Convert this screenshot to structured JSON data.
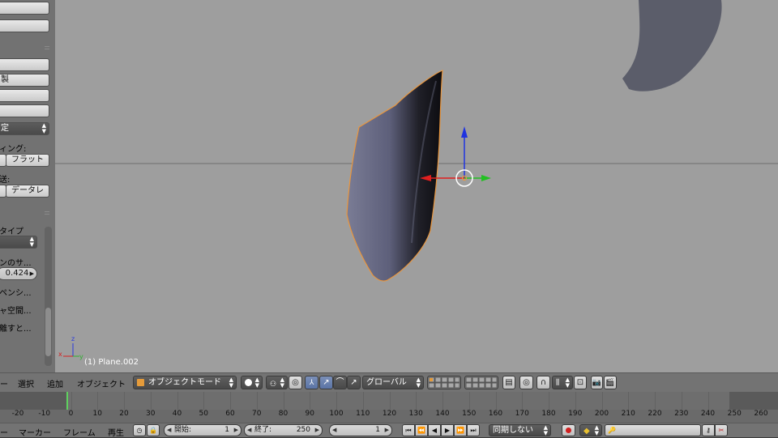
{
  "shelf": {
    "partial_labels": {
      "duplicate": "製",
      "set": "定",
      "shading_label": "ィング:",
      "flat_button": "フラット",
      "transfer_label": "送:",
      "data_button": "データレ",
      "type_label": "タイプ",
      "sun_label": "ンのサ...",
      "value": "0.424",
      "compensate_label": "ペンシ...",
      "space_label": "ャ空間...",
      "distance_label": "離すと..."
    }
  },
  "viewport": {
    "object_name": "(1) Plane.002",
    "axis_labels": {
      "x": "x",
      "y": "y",
      "z": "z"
    }
  },
  "header": {
    "menus": {
      "partial": "ー",
      "select": "選択",
      "add": "追加",
      "object": "オブジェクト"
    },
    "mode": "オブジェクトモード",
    "orientation": "グローバル"
  },
  "timeline": {
    "ticks": [
      "-20",
      "-10",
      "0",
      "10",
      "20",
      "30",
      "40",
      "50",
      "60",
      "70",
      "80",
      "90",
      "100",
      "110",
      "120",
      "130",
      "140",
      "150",
      "160",
      "170",
      "180",
      "190",
      "200",
      "210",
      "220",
      "230",
      "240",
      "250",
      "260"
    ]
  },
  "bottom": {
    "menus": {
      "partial": "ー",
      "marker": "マーカー",
      "frame": "フレーム",
      "playback": "再生"
    },
    "start_label": "開始:",
    "start_value": "1",
    "end_label": "終了:",
    "end_value": "250",
    "current_frame": "1",
    "sync": "同期しない"
  }
}
